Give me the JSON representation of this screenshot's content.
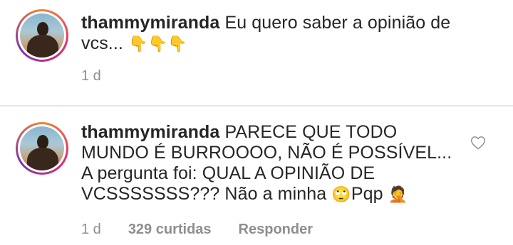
{
  "comments": [
    {
      "username": "thammymiranda",
      "text_line1": " Eu quero saber a opinião de",
      "text_line2": "vcs... ",
      "emojis": "👇👇👇",
      "time": "1 d"
    },
    {
      "username": "thammymiranda",
      "text_line1": " PARECE QUE TODO",
      "text_line2": "MUNDO É BURROOOO, NÃO É POSSÍVEL...",
      "text_line3": "A pergunta foi: QUAL A OPINIÃO DE",
      "text_line4": "VCSSSSSSS??? Não a minha ",
      "emoji_eyes": "🙄",
      "text_tail": "Pqp ",
      "emoji_person": "🤦",
      "time": "1 d",
      "likes": "329 curtidas",
      "reply": "Responder"
    }
  ],
  "icons": {
    "like": "heart-outline-icon"
  },
  "colors": {
    "text": "#262626",
    "meta": "#8e8e8e",
    "divider": "#e6e6e6"
  }
}
